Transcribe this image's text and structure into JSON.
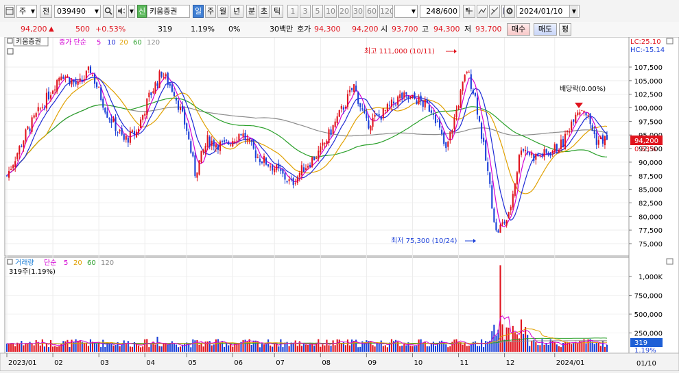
{
  "toolbar": {
    "period_select": "주",
    "prev_label": "전",
    "code": "039490",
    "stock_badge": "신",
    "stock_name": "키움증권",
    "period_tabs": [
      "일",
      "주",
      "월",
      "년",
      "분",
      "초",
      "틱"
    ],
    "active_period": "일",
    "num_tabs": [
      "1",
      "3",
      "5",
      "10",
      "20",
      "30",
      "60",
      "120"
    ],
    "count": "248",
    "total": "/600",
    "date": "2024/01/10"
  },
  "quote": {
    "price": "94,200",
    "change": "500",
    "change_pct": "+0.53%",
    "volume": "319",
    "volume_pct": "1.19%",
    "zero_pct": "0%",
    "amount_label": "30백만",
    "ask_label": "호가",
    "ask1": "94,300",
    "ask2": "94,200",
    "open_label": "시",
    "open": "93,700",
    "high_label": "고",
    "high": "94,300",
    "low_label": "저",
    "low": "93,700",
    "buy_button": "매수",
    "sell_button": "매도",
    "eval_button": "평"
  },
  "chart_data": {
    "type": "candlestick",
    "price_legend": {
      "name": "키움증권",
      "ma_label": "종가 단순",
      "periods": [
        "5",
        "10",
        "20",
        "60",
        "120"
      ]
    },
    "volume_legend": {
      "name": "거래량",
      "ma_label": "단순",
      "periods": [
        "5",
        "20",
        "60",
        "120"
      ]
    },
    "volume_info": "319주(1.19%)",
    "lc": "LC:25.10",
    "hc": "HC:-15.14",
    "current_price": "94,200",
    "current_pct": "0.53%",
    "current_volume": "319",
    "current_volume_pct": "1.19%",
    "annotations": {
      "high": "최고 111,000 (10/11)",
      "low": "최저 75,300 (10/24)",
      "dividend": "배당락(0.00%)"
    },
    "y_ticks": [
      "107,500",
      "105,000",
      "102,500",
      "100,000",
      "97,500",
      "95,000",
      "92,500",
      "90,000",
      "87,500",
      "85,000",
      "82,500",
      "80,000",
      "77,500",
      "75,000"
    ],
    "y_ticks_values": [
      107500,
      105000,
      102500,
      100000,
      97500,
      95000,
      92500,
      90000,
      87500,
      85000,
      82500,
      80000,
      77500,
      75000
    ],
    "volume_ticks": [
      "1,000K",
      "750,000",
      "500,000",
      "250,000"
    ],
    "volume_ticks_values": [
      1000000,
      750000,
      500000,
      250000
    ],
    "x_labels": [
      "2023/01",
      "02",
      "03",
      "04",
      "05",
      "06",
      "07",
      "08",
      "09",
      "10",
      "11",
      "12",
      "2024/01"
    ],
    "x_right_label": "01/10",
    "anchors": [
      [
        0,
        87500
      ],
      [
        10,
        96000
      ],
      [
        18,
        101000
      ],
      [
        26,
        106500
      ],
      [
        34,
        104000
      ],
      [
        40,
        107000
      ],
      [
        48,
        99000
      ],
      [
        56,
        94000
      ],
      [
        62,
        95500
      ],
      [
        68,
        102000
      ],
      [
        74,
        106500
      ],
      [
        80,
        103000
      ],
      [
        86,
        96000
      ],
      [
        90,
        88000
      ],
      [
        96,
        94000
      ],
      [
        104,
        93000
      ],
      [
        112,
        95500
      ],
      [
        120,
        91000
      ],
      [
        128,
        89000
      ],
      [
        136,
        86000
      ],
      [
        142,
        89000
      ],
      [
        150,
        92000
      ],
      [
        158,
        98000
      ],
      [
        166,
        104000
      ],
      [
        172,
        97000
      ],
      [
        180,
        99000
      ],
      [
        188,
        102000
      ],
      [
        196,
        101500
      ],
      [
        204,
        99500
      ],
      [
        210,
        92000
      ],
      [
        214,
        98000
      ],
      [
        220,
        107000
      ],
      [
        224,
        102000
      ],
      [
        230,
        88000
      ],
      [
        234,
        77000
      ],
      [
        240,
        80000
      ],
      [
        246,
        93000
      ],
      [
        252,
        91000
      ],
      [
        258,
        91500
      ],
      [
        266,
        93500
      ],
      [
        272,
        99500
      ],
      [
        276,
        100000
      ],
      [
        282,
        94000
      ],
      [
        287,
        94200
      ]
    ],
    "volume_spikes": [
      [
        72,
        200000
      ],
      [
        236,
        1150000
      ],
      [
        240,
        320000
      ],
      [
        246,
        430000
      ]
    ]
  }
}
